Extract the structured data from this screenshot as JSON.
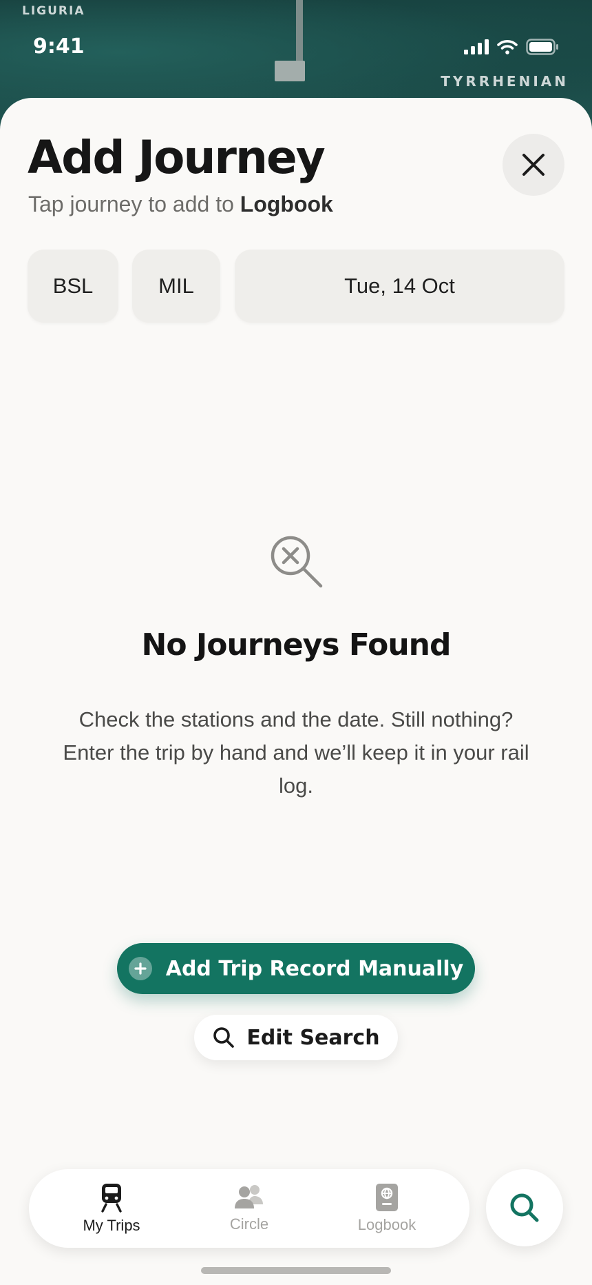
{
  "map": {
    "label_top_left": "LIGURIA",
    "label_right": "TYRRHENIAN"
  },
  "status_bar": {
    "time": "9:41",
    "icons": [
      "cellular-signal-icon",
      "wifi-icon",
      "battery-icon"
    ]
  },
  "sheet": {
    "title": "Add Journey",
    "subtitle_prefix": "Tap journey to add to ",
    "subtitle_emphasis": "Logbook",
    "close_icon": "close-icon"
  },
  "search": {
    "from": "BSL",
    "to": "MIL",
    "date": "Tue, 14 Oct"
  },
  "empty_state": {
    "icon": "search-no-results-icon",
    "title": "No Journeys Found",
    "body": "Check the stations and the date. Still nothing? Enter the trip by hand and we’ll keep it in your rail log.",
    "primary_button": "Add Trip Record Manually",
    "secondary_button": "Edit Search"
  },
  "tabbar": {
    "tabs": [
      {
        "label": "My Trips",
        "icon": "train-icon",
        "active": true
      },
      {
        "label": "Circle",
        "icon": "people-icon",
        "active": false
      },
      {
        "label": "Logbook",
        "icon": "logbook-icon",
        "active": false
      }
    ],
    "fab_icon": "search-icon"
  },
  "colors": {
    "accent": "#137461",
    "sheet_background": "#faf9f7",
    "chip_background": "#efeeeb",
    "inactive_tab": "#a5a4a1"
  }
}
